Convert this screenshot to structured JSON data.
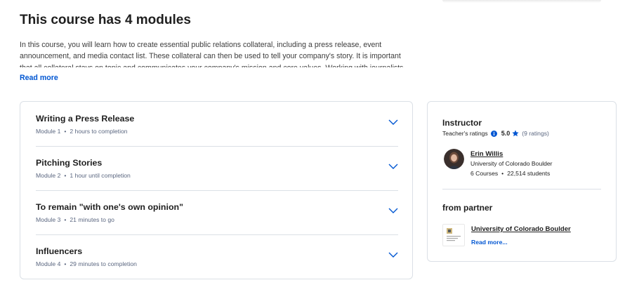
{
  "about": {
    "title": "This course has 4 modules",
    "description": "In this course, you will learn how to create essential public relations collateral, including a press release, event announcement, and media contact list. These collateral can then be used to tell your company's story. It is important that all collateral stays on topic and communicates your company's mission and core values. Working with journalists and other media professionals can sometimes be",
    "read_more": "Read more"
  },
  "modules": [
    {
      "title": "Writing a Press Release",
      "module_label": "Module 1",
      "duration": "2 hours to completion"
    },
    {
      "title": "Pitching Stories",
      "module_label": "Module 2",
      "duration": "1 hour until completion"
    },
    {
      "title": "To remain \"with one's own opinion\"",
      "module_label": "Module 3",
      "duration": "21 minutes to go"
    },
    {
      "title": "Influencers",
      "module_label": "Module 4",
      "duration": "29 minutes to completion"
    }
  ],
  "instructor": {
    "heading": "Instructor",
    "ratings_label": "Teacher's ratings",
    "rating": "5.0",
    "rating_count": "(9 ratings)",
    "name": "Erin Willis",
    "university": "University of Colorado Boulder",
    "courses": "6 Courses",
    "students": "22,514 students"
  },
  "partner": {
    "heading": "from partner",
    "name": "University of Colorado Boulder",
    "read_more": "Read more...",
    "logo_text": "University of Colorado Boulder"
  },
  "colors": {
    "link_blue": "#0056d2",
    "border": "#dbe0e6",
    "text": "#1f1f1f",
    "muted": "#5b6780"
  }
}
